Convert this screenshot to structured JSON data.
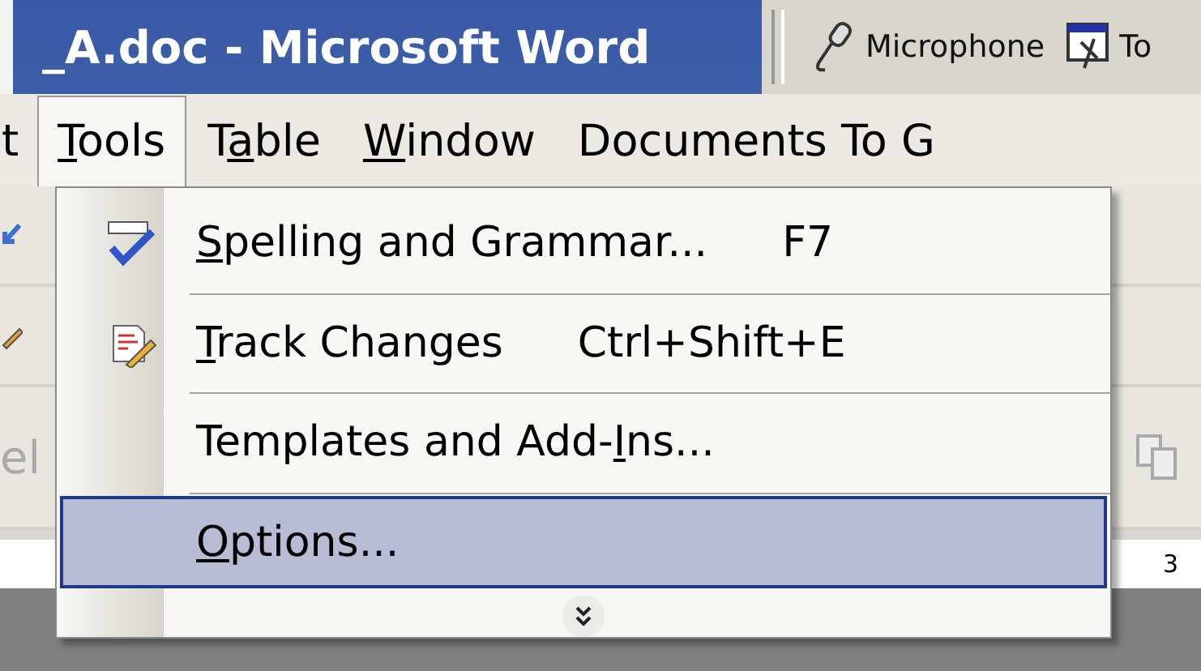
{
  "window": {
    "title": "_A.doc - Microsoft Word"
  },
  "toolbar_buttons": [
    {
      "label": "Microphone"
    },
    {
      "label": "To"
    }
  ],
  "menu_bar": [
    {
      "label": [
        {
          "text": "t",
          "underlined": false
        }
      ],
      "selected": false
    },
    {
      "label": [
        {
          "text": "T",
          "underlined": true
        },
        {
          "text": "ools",
          "underlined": false
        }
      ],
      "selected": true
    },
    {
      "label": [
        {
          "text": "T",
          "underlined": false
        },
        {
          "text": "a",
          "underlined": true
        },
        {
          "text": "ble",
          "underlined": false
        }
      ],
      "selected": false
    },
    {
      "label": [
        {
          "text": "W",
          "underlined": true
        },
        {
          "text": "indow",
          "underlined": false
        }
      ],
      "selected": false
    },
    {
      "label": [
        {
          "text": "Documents To G",
          "underlined": false
        }
      ],
      "selected": false
    }
  ],
  "menu": {
    "items": [
      {
        "label": [
          {
            "text": "S",
            "underlined": true
          },
          {
            "text": "pelling and Grammar...",
            "underlined": false
          }
        ],
        "shortcut": "F7",
        "kind": "spelling",
        "selected": false
      },
      {
        "label": [
          {
            "text": "T",
            "underlined": true
          },
          {
            "text": "rack Changes",
            "underlined": false
          }
        ],
        "shortcut": "Ctrl+Shift+E",
        "kind": "track",
        "selected": false
      },
      {
        "label": [
          {
            "text": "Templates and Add-",
            "underlined": false
          },
          {
            "text": "I",
            "underlined": true
          },
          {
            "text": "ns...",
            "underlined": false
          }
        ],
        "selected": false
      },
      {
        "label": [
          {
            "text": "O",
            "underlined": true
          },
          {
            "text": "ptions...",
            "underlined": false
          }
        ],
        "selected": true
      }
    ]
  },
  "background": {
    "toolbar_text": "el",
    "ruler_number": "3"
  }
}
